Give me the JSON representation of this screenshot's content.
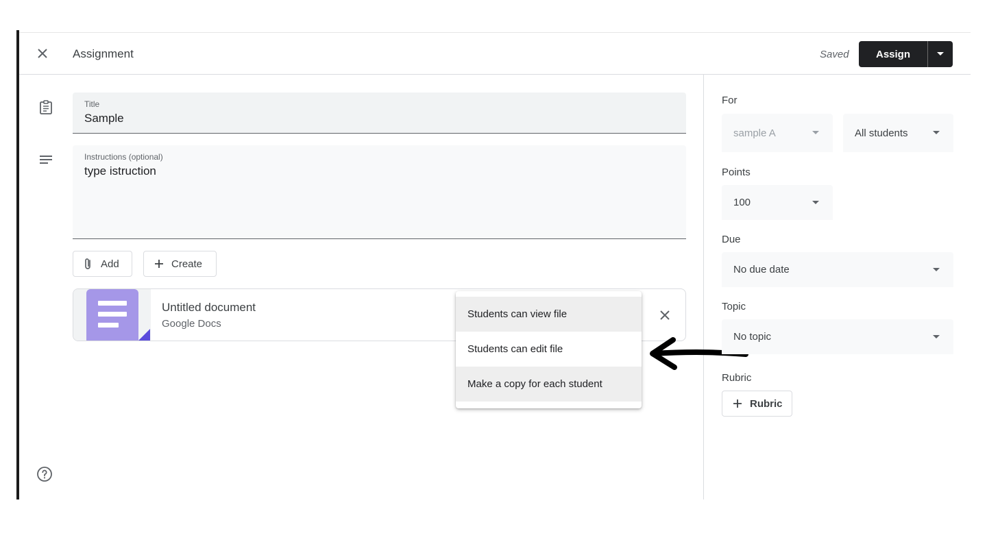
{
  "header": {
    "title": "Assignment",
    "status": "Saved",
    "assign_label": "Assign"
  },
  "form": {
    "title_label": "Title",
    "title_value": "Sample",
    "instructions_label": "Instructions (optional)",
    "instructions_value": "type istruction",
    "add_label": "Add",
    "create_label": "Create"
  },
  "attachment": {
    "name": "Untitled document",
    "type": "Google Docs"
  },
  "share_menu": {
    "items": [
      {
        "label": "Students can view file",
        "highlighted": true
      },
      {
        "label": "Students can edit file",
        "highlighted": false
      },
      {
        "label": "Make a copy for each student",
        "highlighted": true
      }
    ]
  },
  "sidebar": {
    "for_label": "For",
    "class_value": "sample A",
    "students_value": "All students",
    "points_label": "Points",
    "points_value": "100",
    "due_label": "Due",
    "due_value": "No due date",
    "topic_label": "Topic",
    "topic_value": "No topic",
    "rubric_label": "Rubric",
    "rubric_button": "Rubric"
  },
  "colors": {
    "primary_button": "#202124",
    "doc_thumbnail": "#a597e8",
    "doc_corner": "#5b4bdc",
    "field_bg": "#f1f3f4"
  },
  "icons": [
    "close-icon",
    "chevron-down-icon",
    "assignment-icon",
    "notes-icon",
    "paperclip-icon",
    "plus-icon",
    "help-icon",
    "arrow-annotation"
  ]
}
